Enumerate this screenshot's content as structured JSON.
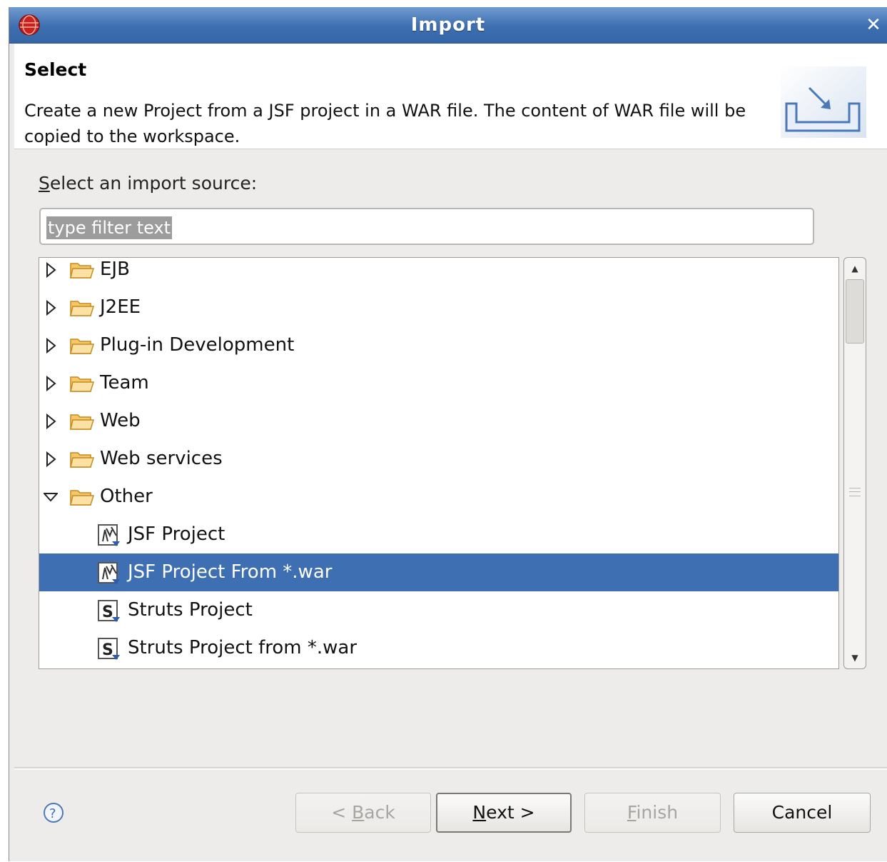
{
  "window": {
    "title": "Import",
    "close_label": "✕"
  },
  "banner": {
    "title": "Select",
    "description": "Create a new Project from a JSF project in a WAR file. The content of WAR file will be copied to the workspace."
  },
  "source": {
    "label_prefix": "S",
    "label_rest": "elect an import source:",
    "filter_placeholder": "type filter text"
  },
  "tree": {
    "folders": [
      {
        "label": "EJB",
        "expanded": false
      },
      {
        "label": "J2EE",
        "expanded": false
      },
      {
        "label": "Plug-in Development",
        "expanded": false
      },
      {
        "label": "Team",
        "expanded": false
      },
      {
        "label": "Web",
        "expanded": false
      },
      {
        "label": "Web services",
        "expanded": false
      },
      {
        "label": "Other",
        "expanded": true
      }
    ],
    "children": [
      {
        "label": "JSF Project",
        "icon": "jsf-project-icon",
        "selected": false
      },
      {
        "label": "JSF Project From *.war",
        "icon": "jsf-project-icon",
        "selected": true
      },
      {
        "label": "Struts Project",
        "icon": "struts-project-icon",
        "selected": false
      },
      {
        "label": "Struts Project from *.war",
        "icon": "struts-project-icon",
        "selected": false
      }
    ]
  },
  "buttons": {
    "back": {
      "prefix": "< ",
      "mnemonic": "B",
      "rest": "ack",
      "enabled": false
    },
    "next": {
      "mnemonic": "N",
      "rest": "ext >",
      "enabled": true
    },
    "finish": {
      "mnemonic": "F",
      "rest": "inish",
      "enabled": false
    },
    "cancel": {
      "label": "Cancel",
      "enabled": true
    }
  },
  "colors": {
    "selection": "#3e6fb3",
    "titlebar": "#3d6eb0",
    "dialog_bg": "#edeceb"
  }
}
